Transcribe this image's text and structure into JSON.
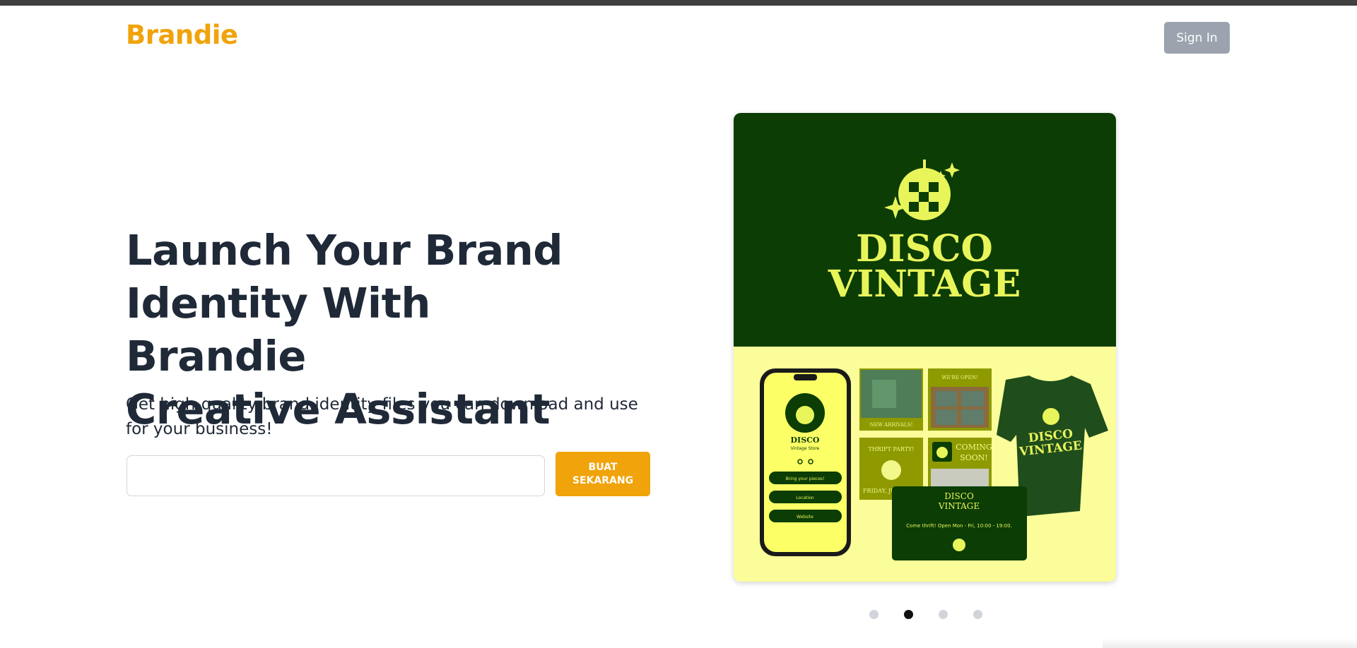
{
  "header": {
    "logo_text": "Brandie",
    "signin_label": "Sign In"
  },
  "hero": {
    "headline_lines": [
      "Launch Your Brand",
      "Identity With Brandie",
      "Creative Assistant"
    ],
    "subtitle": "Get high-quality brand identity files you can download and use for your business!",
    "input_value": "",
    "cta_lines": [
      "BUAT",
      "SEKARANG"
    ]
  },
  "carousel": {
    "slide": {
      "brand_title_line1": "DISCO",
      "brand_title_line2": "VINTAGE",
      "phone_name": "DISCO",
      "phone_tagline": "Vintage Store",
      "phone_buttons": [
        "Bring your pieces!",
        "Location",
        "Website"
      ],
      "tile_new_arrivals": "NEW ARRIVALS!",
      "tile_open_title": "WE'RE OPEN!",
      "tile_thrift_title": "THRIFT PARTY!",
      "tile_thrift_date": "FRIDAY, JU",
      "tile_coming_line1": "COMING",
      "tile_coming_line2": "SOON!",
      "card_title_line1": "DISCO",
      "card_title_line2": "VINTAGE",
      "card_text": "Come thrift! Open Mon - Fri, 10:00 - 19:00.",
      "shirt_line1": "DISCO",
      "shirt_line2": "VINTAGE"
    },
    "dots_count": 4,
    "active_dot": 1
  },
  "colors": {
    "brand_orange": "#f0a30a",
    "dark_green": "#0b3d05",
    "pale_yellow": "#fbfd9a",
    "logo_yellow": "#e8f55a"
  }
}
